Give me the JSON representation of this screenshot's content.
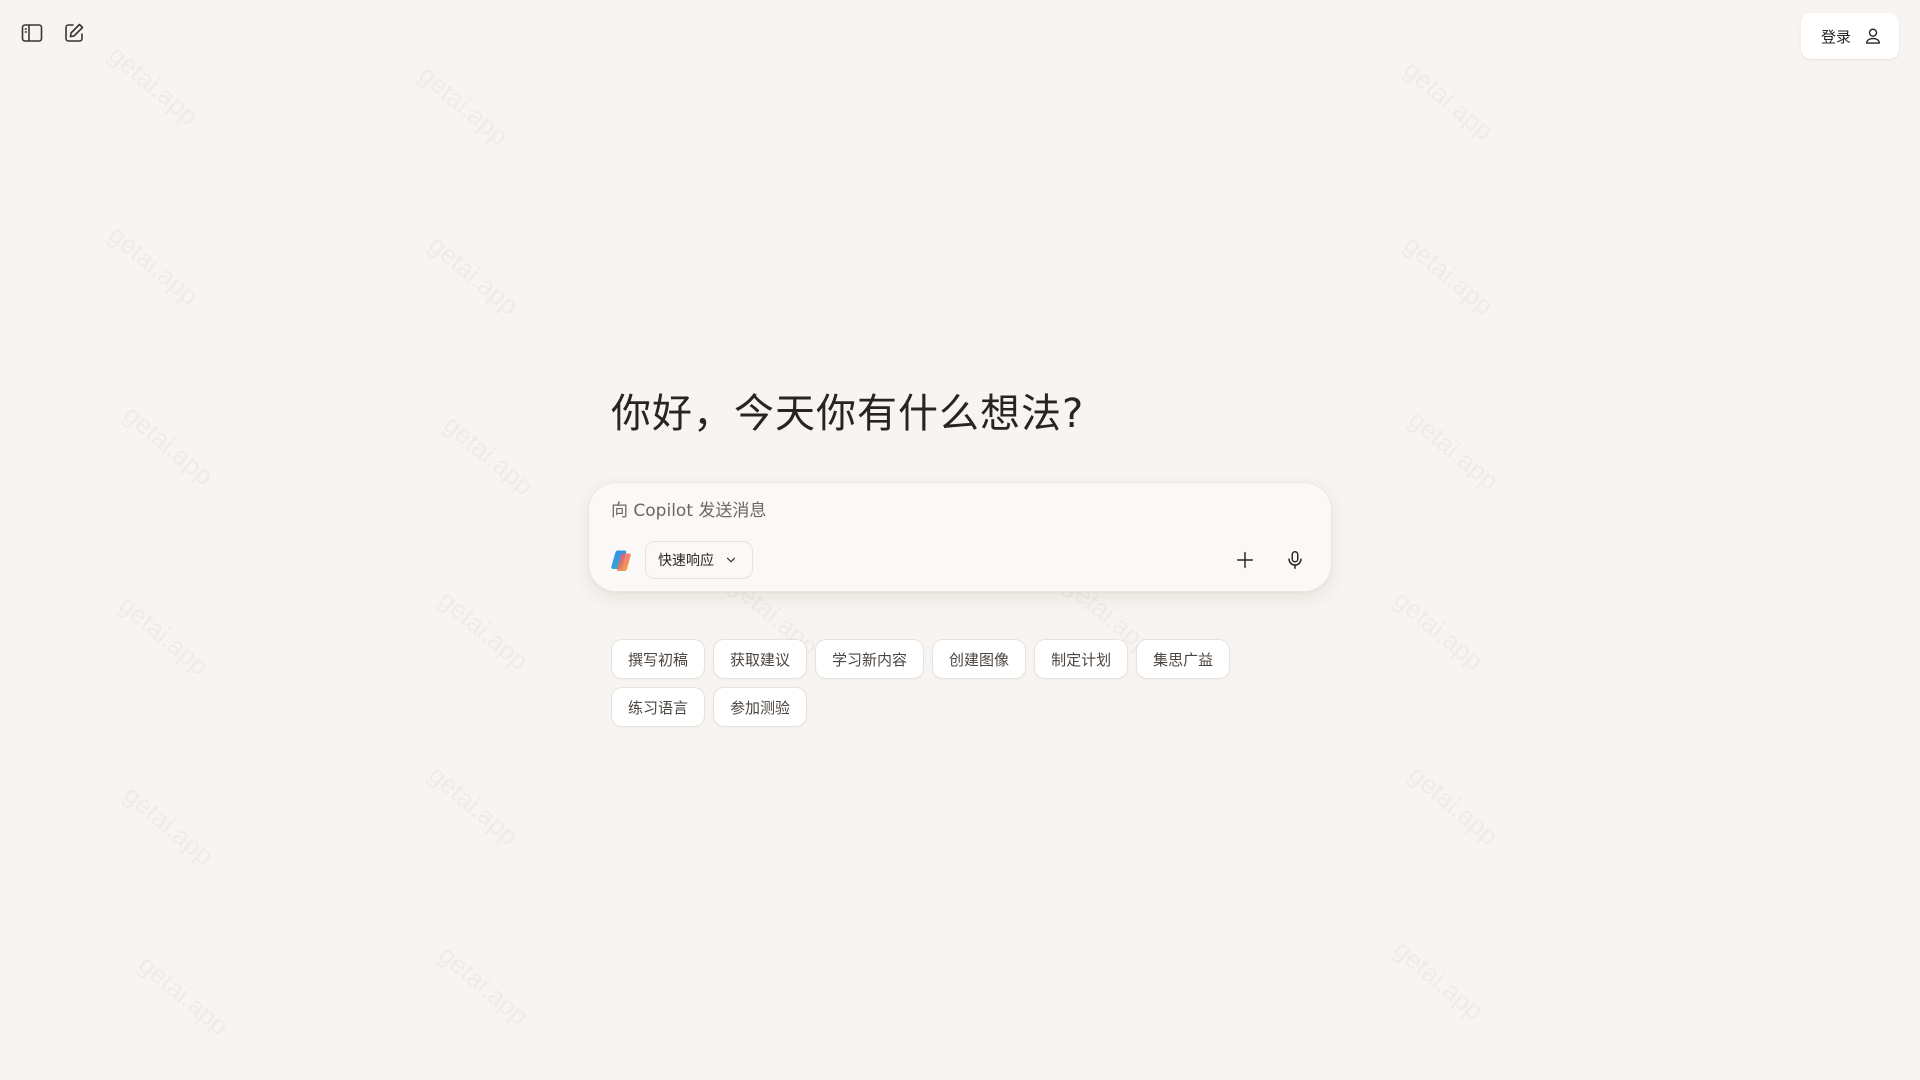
{
  "header": {
    "login_label": "登录",
    "icons": [
      "sidebar-toggle-icon",
      "new-chat-icon",
      "user-icon"
    ]
  },
  "main": {
    "greeting": "你好，今天你有什么想法?",
    "composer": {
      "placeholder": "向 Copilot 发送消息",
      "value": "",
      "mode_label": "快速响应",
      "icons": [
        "copilot-logo-icon",
        "chevron-down-icon",
        "plus-icon",
        "microphone-icon"
      ]
    },
    "suggestions": [
      "撰写初稿",
      "获取建议",
      "学习新内容",
      "创建图像",
      "制定计划",
      "集思广益",
      "练习语言",
      "参加测验"
    ]
  },
  "watermark": "getai.app",
  "colors": {
    "background": "#f7f4f1",
    "surface": "#ffffff",
    "text": "#2a2623",
    "border": "#e8e2dc"
  }
}
